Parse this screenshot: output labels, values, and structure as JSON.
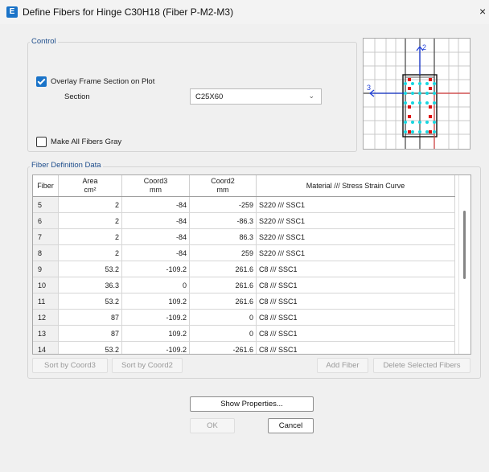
{
  "window": {
    "app_icon": "E",
    "title": "Define Fibers for Hinge C30H18  (Fiber P-M2-M3)",
    "close_glyph": "×"
  },
  "control": {
    "group_label": "Control",
    "overlay_label": "Overlay Frame Section on Plot",
    "overlay_checked": true,
    "section_label": "Section",
    "section_value": "C25X60",
    "gray_label": "Make All Fibers Gray",
    "gray_checked": false
  },
  "preview": {
    "axis2_label": "2",
    "axis3_label": "3"
  },
  "fibers": {
    "group_label": "Fiber Definition Data",
    "headers": {
      "fiber": "Fiber",
      "area": "Area",
      "area_unit": "cm²",
      "coord3": "Coord3",
      "coord3_unit": "mm",
      "coord2": "Coord2",
      "coord2_unit": "mm",
      "material": "Material  ///  Stress Strain Curve"
    },
    "rows": [
      {
        "fiber": "5",
        "area": "2",
        "coord3": "-84",
        "coord2": "-259",
        "material": "S220  ///  SSC1"
      },
      {
        "fiber": "6",
        "area": "2",
        "coord3": "-84",
        "coord2": "-86.3",
        "material": "S220  ///  SSC1"
      },
      {
        "fiber": "7",
        "area": "2",
        "coord3": "-84",
        "coord2": "86.3",
        "material": "S220  ///  SSC1"
      },
      {
        "fiber": "8",
        "area": "2",
        "coord3": "-84",
        "coord2": "259",
        "material": "S220  ///  SSC1"
      },
      {
        "fiber": "9",
        "area": "53.2",
        "coord3": "-109.2",
        "coord2": "261.6",
        "material": "C8  ///  SSC1"
      },
      {
        "fiber": "10",
        "area": "36.3",
        "coord3": "0",
        "coord2": "261.6",
        "material": "C8  ///  SSC1"
      },
      {
        "fiber": "11",
        "area": "53.2",
        "coord3": "109.2",
        "coord2": "261.6",
        "material": "C8  ///  SSC1"
      },
      {
        "fiber": "12",
        "area": "87",
        "coord3": "-109.2",
        "coord2": "0",
        "material": "C8  ///  SSC1"
      },
      {
        "fiber": "13",
        "area": "87",
        "coord3": "109.2",
        "coord2": "0",
        "material": "C8  ///  SSC1"
      },
      {
        "fiber": "14",
        "area": "53.2",
        "coord3": "-109.2",
        "coord2": "-261.6",
        "material": "C8  ///  SSC1"
      }
    ],
    "sort3": "Sort by Coord3",
    "sort2": "Sort by Coord2",
    "add": "Add Fiber",
    "delete": "Delete Selected Fibers"
  },
  "buttons": {
    "show_properties": "Show Properties...",
    "ok": "OK",
    "cancel": "Cancel"
  }
}
